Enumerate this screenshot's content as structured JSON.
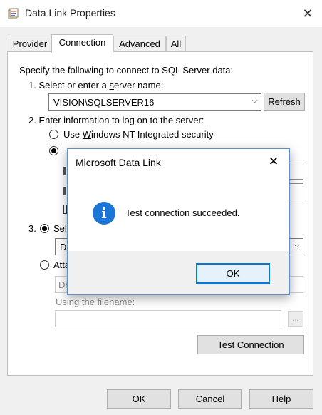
{
  "window": {
    "title": "Data Link Properties",
    "close": "✕"
  },
  "tabs": [
    "Provider",
    "Connection",
    "Advanced",
    "All"
  ],
  "connection": {
    "intro": "Specify the following to connect to SQL Server data:",
    "step1": "1. Select or enter a server name:",
    "server_name": "VISION\\SQLSERVER16",
    "refresh": "Refresh",
    "step2": "2. Enter information to log on to the server:",
    "opt_windows": "Use Windows NT Integrated security",
    "step3": "3.",
    "sel_partial": "Sel",
    "db_partial": "Db",
    "att_partial": "Atta",
    "db_partial2": "Db",
    "filename_label": "Using the filename:",
    "browse": "...",
    "test_connection": "Test Connection"
  },
  "footer": {
    "ok": "OK",
    "cancel": "Cancel",
    "help": "Help"
  },
  "dialog": {
    "title": "Microsoft Data Link",
    "close": "✕",
    "icon": "i",
    "message": "Test connection succeeded.",
    "ok": "OK"
  }
}
